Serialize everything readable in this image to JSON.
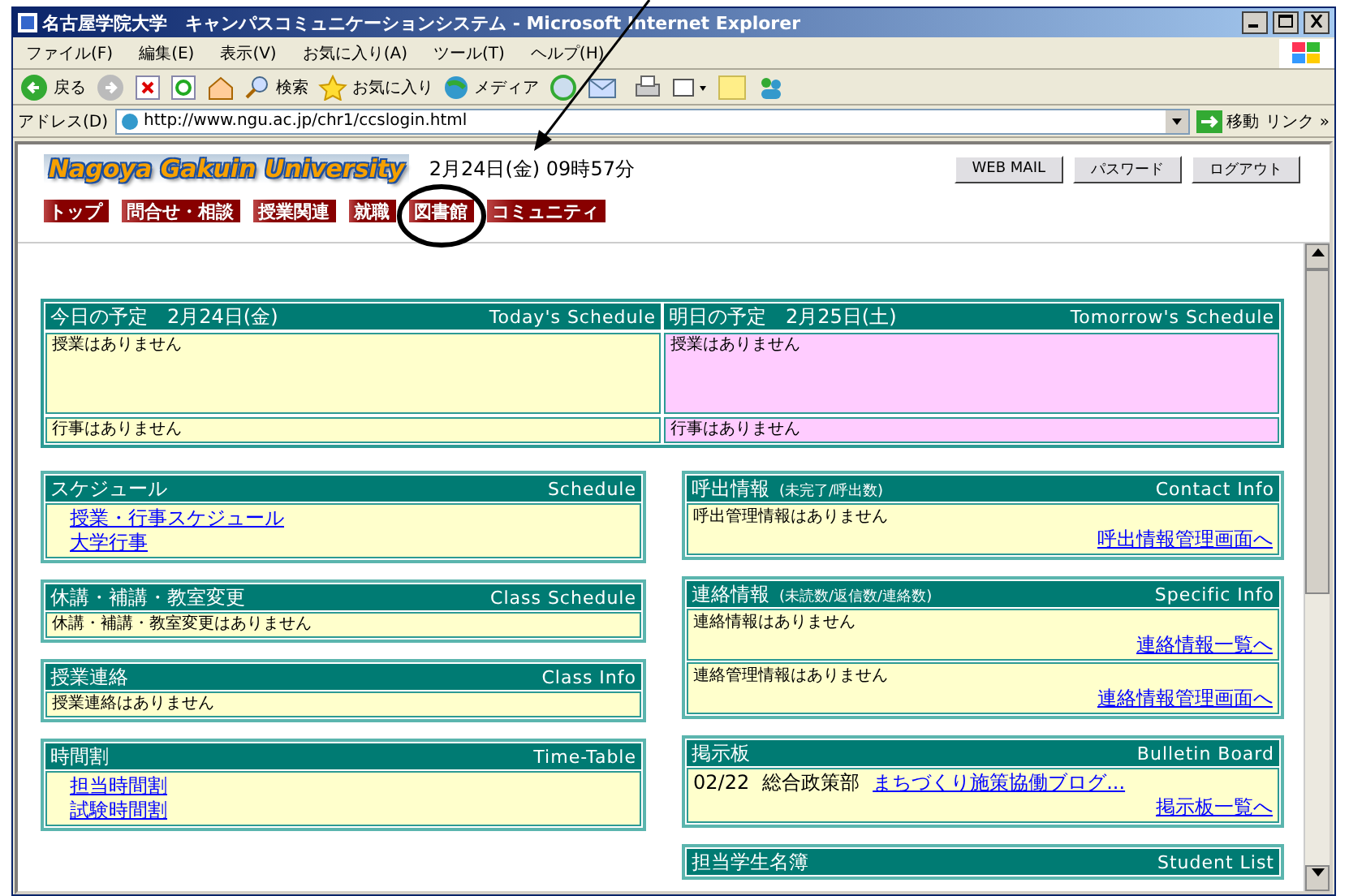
{
  "window": {
    "title": "名古屋学院大学　キャンパスコミュニケーションシステム - Microsoft Internet Explorer"
  },
  "menu": [
    "ファイル(F)",
    "編集(E)",
    "表示(V)",
    "お気に入り(A)",
    "ツール(T)",
    "ヘルプ(H)"
  ],
  "toolbar": {
    "back": "戻る",
    "search": "検索",
    "favorites": "お気に入り",
    "media": "メディア"
  },
  "address": {
    "label": "アドレス(D)",
    "url": "http://www.ngu.ac.jp/chr1/ccslogin.html",
    "go": "移動",
    "links": "リンク",
    "more": "»"
  },
  "header": {
    "logo": "Nagoya Gakuin University",
    "datetime": "2月24日(金) 09時57分",
    "buttons": [
      "WEB MAIL",
      "パスワード",
      "ログアウト"
    ],
    "nav": [
      "トップ",
      "問合せ・相談",
      "授業関連",
      "就職",
      "図書館",
      "コミュニティ"
    ]
  },
  "days": [
    {
      "title": "今日の予定　2月24日(金)",
      "en": "Today's Schedule",
      "classes": "授業はありません",
      "events": "行事はありません",
      "color": "#ffffcc"
    },
    {
      "title": "明日の予定　2月25日(土)",
      "en": "Tomorrow's Schedule",
      "classes": "授業はありません",
      "events": "行事はありません",
      "color": "#ffccff"
    }
  ],
  "left_panels": [
    {
      "title": "スケジュール",
      "en": "Schedule",
      "kind": "links",
      "items": [
        "授業・行事スケジュール",
        "大学行事"
      ]
    },
    {
      "title": "休講・補講・教室変更",
      "en": "Class Schedule",
      "kind": "message",
      "items": [
        "休講・補講・教室変更はありません"
      ]
    },
    {
      "title": "授業連絡",
      "en": "Class Info",
      "kind": "message",
      "items": [
        "授業連絡はありません"
      ]
    },
    {
      "title": "時間割",
      "en": "Time-Table",
      "kind": "links",
      "items": [
        "担当時間割",
        "試験時間割"
      ]
    }
  ],
  "right_panels": [
    {
      "title": "呼出情報",
      "sub": "(未完了/呼出数)",
      "en": "Contact Info",
      "sections": [
        {
          "text": "呼出管理情報はありません",
          "link": "呼出情報管理画面へ"
        }
      ]
    },
    {
      "title": "連絡情報",
      "sub": "(未読数/返信数/連絡数)",
      "en": "Specific Info",
      "sections": [
        {
          "text": "連絡情報はありません",
          "link": "連絡情報一覧へ"
        },
        {
          "text": "連絡管理情報はありません",
          "link": "連絡情報管理画面へ"
        }
      ]
    },
    {
      "title": "掲示板",
      "en": "Bulletin Board",
      "bulletin": {
        "date": "02/22",
        "dept": "総合政策部",
        "link": "まちづくり施策協働ブログ..."
      },
      "sections": [
        {
          "link": "掲示板一覧へ"
        }
      ]
    },
    {
      "title": "担当学生名簿",
      "en": "Student List"
    }
  ]
}
